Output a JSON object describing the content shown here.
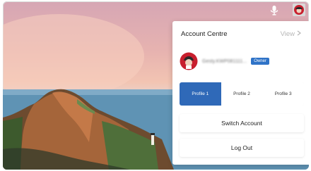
{
  "panel": {
    "title": "Account Centre",
    "view_label": "View",
    "user_name": "Gesty.KWP081111...",
    "owner_badge": "Owner",
    "profiles": [
      "Profile 1",
      "Profile 2",
      "Profile 3"
    ],
    "selected_profile": 0,
    "switch_account_label": "Switch Account",
    "logout_label": "Log Out"
  },
  "colors": {
    "accent": "#2f69b8",
    "badge": "#2f73c7"
  },
  "icons": {
    "mic": "mic-icon",
    "avatar": "avatar-icon",
    "chevron": "chevron-right-icon"
  }
}
